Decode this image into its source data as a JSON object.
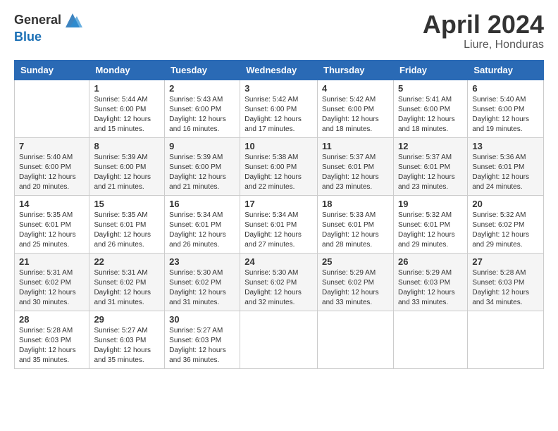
{
  "logo": {
    "general": "General",
    "blue": "Blue"
  },
  "header": {
    "month": "April 2024",
    "location": "Liure, Honduras"
  },
  "columns": [
    "Sunday",
    "Monday",
    "Tuesday",
    "Wednesday",
    "Thursday",
    "Friday",
    "Saturday"
  ],
  "weeks": [
    [
      {
        "day": "",
        "info": ""
      },
      {
        "day": "1",
        "info": "Sunrise: 5:44 AM\nSunset: 6:00 PM\nDaylight: 12 hours\nand 15 minutes."
      },
      {
        "day": "2",
        "info": "Sunrise: 5:43 AM\nSunset: 6:00 PM\nDaylight: 12 hours\nand 16 minutes."
      },
      {
        "day": "3",
        "info": "Sunrise: 5:42 AM\nSunset: 6:00 PM\nDaylight: 12 hours\nand 17 minutes."
      },
      {
        "day": "4",
        "info": "Sunrise: 5:42 AM\nSunset: 6:00 PM\nDaylight: 12 hours\nand 18 minutes."
      },
      {
        "day": "5",
        "info": "Sunrise: 5:41 AM\nSunset: 6:00 PM\nDaylight: 12 hours\nand 18 minutes."
      },
      {
        "day": "6",
        "info": "Sunrise: 5:40 AM\nSunset: 6:00 PM\nDaylight: 12 hours\nand 19 minutes."
      }
    ],
    [
      {
        "day": "7",
        "info": "Sunrise: 5:40 AM\nSunset: 6:00 PM\nDaylight: 12 hours\nand 20 minutes."
      },
      {
        "day": "8",
        "info": "Sunrise: 5:39 AM\nSunset: 6:00 PM\nDaylight: 12 hours\nand 21 minutes."
      },
      {
        "day": "9",
        "info": "Sunrise: 5:39 AM\nSunset: 6:00 PM\nDaylight: 12 hours\nand 21 minutes."
      },
      {
        "day": "10",
        "info": "Sunrise: 5:38 AM\nSunset: 6:00 PM\nDaylight: 12 hours\nand 22 minutes."
      },
      {
        "day": "11",
        "info": "Sunrise: 5:37 AM\nSunset: 6:01 PM\nDaylight: 12 hours\nand 23 minutes."
      },
      {
        "day": "12",
        "info": "Sunrise: 5:37 AM\nSunset: 6:01 PM\nDaylight: 12 hours\nand 23 minutes."
      },
      {
        "day": "13",
        "info": "Sunrise: 5:36 AM\nSunset: 6:01 PM\nDaylight: 12 hours\nand 24 minutes."
      }
    ],
    [
      {
        "day": "14",
        "info": "Sunrise: 5:35 AM\nSunset: 6:01 PM\nDaylight: 12 hours\nand 25 minutes."
      },
      {
        "day": "15",
        "info": "Sunrise: 5:35 AM\nSunset: 6:01 PM\nDaylight: 12 hours\nand 26 minutes."
      },
      {
        "day": "16",
        "info": "Sunrise: 5:34 AM\nSunset: 6:01 PM\nDaylight: 12 hours\nand 26 minutes."
      },
      {
        "day": "17",
        "info": "Sunrise: 5:34 AM\nSunset: 6:01 PM\nDaylight: 12 hours\nand 27 minutes."
      },
      {
        "day": "18",
        "info": "Sunrise: 5:33 AM\nSunset: 6:01 PM\nDaylight: 12 hours\nand 28 minutes."
      },
      {
        "day": "19",
        "info": "Sunrise: 5:32 AM\nSunset: 6:01 PM\nDaylight: 12 hours\nand 29 minutes."
      },
      {
        "day": "20",
        "info": "Sunrise: 5:32 AM\nSunset: 6:02 PM\nDaylight: 12 hours\nand 29 minutes."
      }
    ],
    [
      {
        "day": "21",
        "info": "Sunrise: 5:31 AM\nSunset: 6:02 PM\nDaylight: 12 hours\nand 30 minutes."
      },
      {
        "day": "22",
        "info": "Sunrise: 5:31 AM\nSunset: 6:02 PM\nDaylight: 12 hours\nand 31 minutes."
      },
      {
        "day": "23",
        "info": "Sunrise: 5:30 AM\nSunset: 6:02 PM\nDaylight: 12 hours\nand 31 minutes."
      },
      {
        "day": "24",
        "info": "Sunrise: 5:30 AM\nSunset: 6:02 PM\nDaylight: 12 hours\nand 32 minutes."
      },
      {
        "day": "25",
        "info": "Sunrise: 5:29 AM\nSunset: 6:02 PM\nDaylight: 12 hours\nand 33 minutes."
      },
      {
        "day": "26",
        "info": "Sunrise: 5:29 AM\nSunset: 6:03 PM\nDaylight: 12 hours\nand 33 minutes."
      },
      {
        "day": "27",
        "info": "Sunrise: 5:28 AM\nSunset: 6:03 PM\nDaylight: 12 hours\nand 34 minutes."
      }
    ],
    [
      {
        "day": "28",
        "info": "Sunrise: 5:28 AM\nSunset: 6:03 PM\nDaylight: 12 hours\nand 35 minutes."
      },
      {
        "day": "29",
        "info": "Sunrise: 5:27 AM\nSunset: 6:03 PM\nDaylight: 12 hours\nand 35 minutes."
      },
      {
        "day": "30",
        "info": "Sunrise: 5:27 AM\nSunset: 6:03 PM\nDaylight: 12 hours\nand 36 minutes."
      },
      {
        "day": "",
        "info": ""
      },
      {
        "day": "",
        "info": ""
      },
      {
        "day": "",
        "info": ""
      },
      {
        "day": "",
        "info": ""
      }
    ]
  ]
}
